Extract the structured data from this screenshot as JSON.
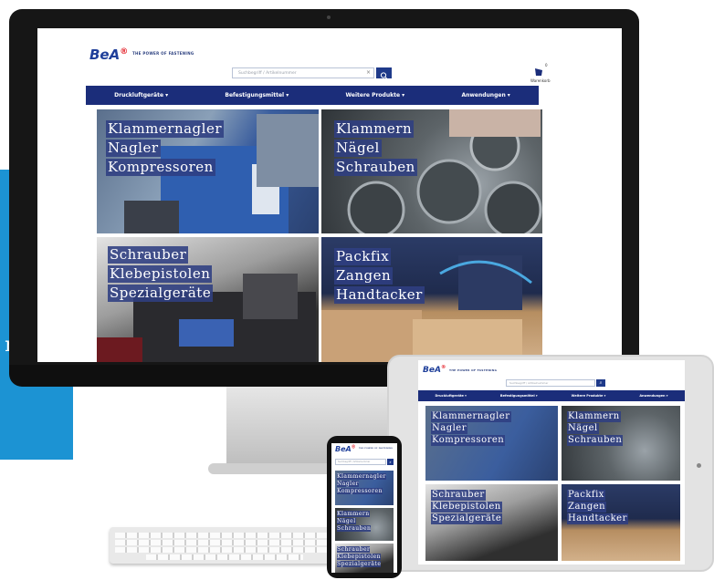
{
  "promo": {
    "text_partial": "m",
    "color": "#1c93d3"
  },
  "site": {
    "logo": "BeA",
    "logo_suffix": "®",
    "tagline": "THE POWER OF FASTENING",
    "search_placeholder": "Suchbegriff / Artikelnummer",
    "search_icon": "magnifier-icon",
    "cart_count": "0",
    "cart_label": "Warenkorb",
    "nav": [
      "Druckluftgeräte ▾",
      "Befestigungsmittel ▾",
      "Weitere Produkte ▾",
      "Anwendungen ▾"
    ],
    "tiles": [
      {
        "lines": [
          "Klammernagler",
          "Nagler",
          "Kompressoren"
        ],
        "theme": "nailer"
      },
      {
        "lines": [
          "Klammern",
          "Nägel",
          "Schrauben"
        ],
        "theme": "coils"
      },
      {
        "lines": [
          "Schrauber",
          "Klebepistolen",
          "Spezialgeräte"
        ],
        "theme": "screwdriver"
      },
      {
        "lines": [
          "Packfix",
          "Zangen",
          "Handtacker"
        ],
        "theme": "boxes"
      }
    ]
  },
  "colors": {
    "nav": "#1b2d7a",
    "label_bg": "#2f3f82",
    "brand_blue": "#1f3f9a",
    "brand_red": "#e31b23"
  }
}
